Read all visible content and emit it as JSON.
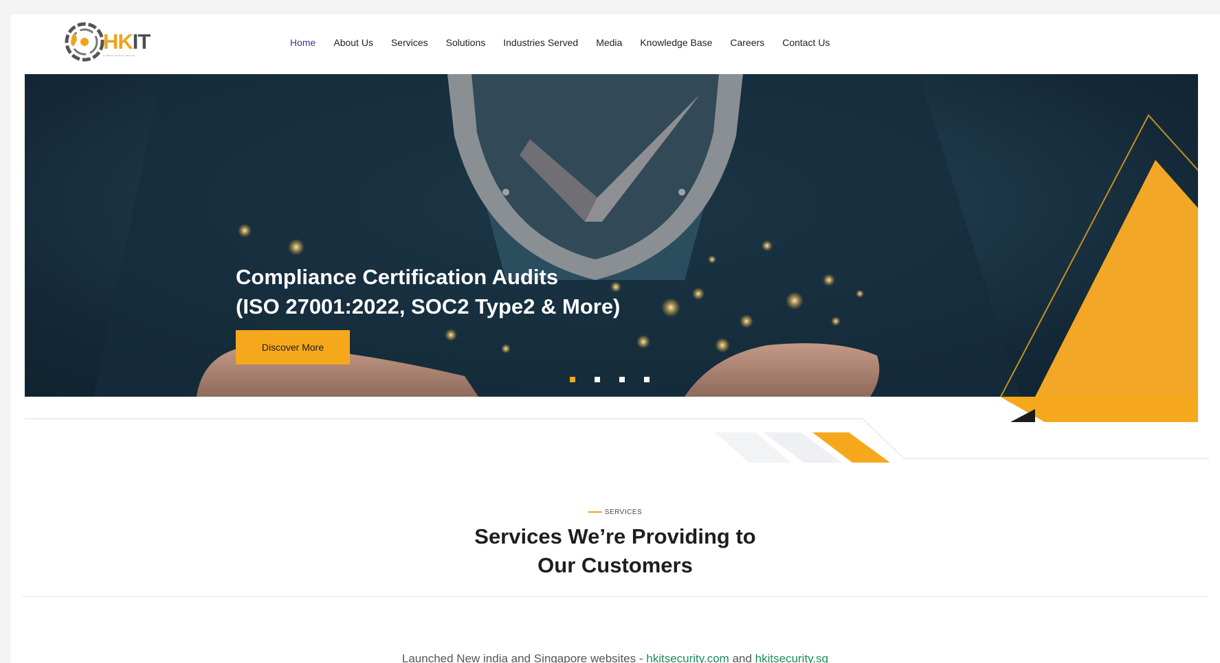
{
  "header": {
    "logo_text_a": "HK",
    "logo_text_b": "IT",
    "logo_tagline": "CYBER EXCELLENCE",
    "nav": [
      {
        "label": "Home",
        "active": true
      },
      {
        "label": "About Us"
      },
      {
        "label": "Services"
      },
      {
        "label": "Solutions"
      },
      {
        "label": "Industries Served"
      },
      {
        "label": "Media"
      },
      {
        "label": "Knowledge Base"
      },
      {
        "label": "Careers"
      },
      {
        "label": "Contact Us"
      }
    ]
  },
  "hero": {
    "title": "Compliance Certification Audits\n(ISO 27001:2022, SOC2 Type2 & More)",
    "cta_label": "Discover More",
    "slides": 4,
    "active_slide": 1
  },
  "services": {
    "eyebrow": "SERVICES",
    "title_line1": "Services We’re Providing to",
    "title_line2": "Our Customers"
  },
  "ticker": {
    "prefix": "Launched New india and Singapore websites - ",
    "link1": "hkitsecurity.com",
    "mid": " and ",
    "link2": "hkitsecurity.sg"
  },
  "colors": {
    "accent": "#f6a81c",
    "nav_active": "#2f3d8a",
    "hero_bg": "#1d3a4a",
    "link_green": "#1e8a5a"
  }
}
